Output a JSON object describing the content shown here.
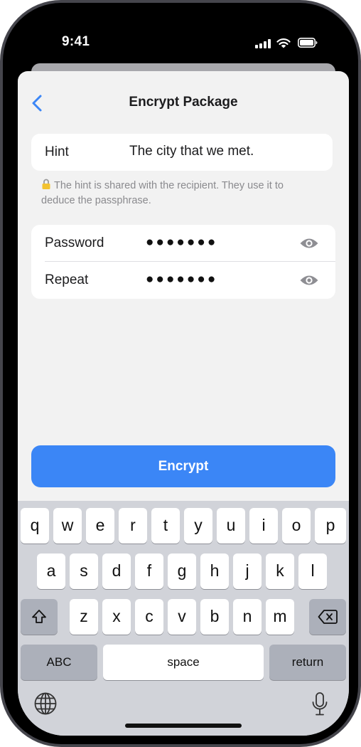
{
  "status": {
    "time": "9:41"
  },
  "nav": {
    "title": "Encrypt Package"
  },
  "hint": {
    "label": "Hint",
    "value": "The city that we met."
  },
  "note": {
    "text": "The hint is shared with the recipient. They use it to deduce the passphrase."
  },
  "password": {
    "label": "Password",
    "masked": "●●●●●●●"
  },
  "repeat": {
    "label": "Repeat",
    "masked": "●●●●●●●"
  },
  "actions": {
    "encrypt_label": "Encrypt"
  },
  "keyboard": {
    "row1": [
      "q",
      "w",
      "e",
      "r",
      "t",
      "y",
      "u",
      "i",
      "o",
      "p"
    ],
    "row2": [
      "a",
      "s",
      "d",
      "f",
      "g",
      "h",
      "j",
      "k",
      "l"
    ],
    "row3": [
      "z",
      "x",
      "c",
      "v",
      "b",
      "n",
      "m"
    ],
    "abc_label": "ABC",
    "space_label": "space",
    "return_label": "return"
  },
  "colors": {
    "accent": "#3b86f6",
    "background": "#f2f2f2",
    "keyboard": "#d1d3d9"
  },
  "icons": [
    "back-chevron-icon",
    "lock-icon",
    "eye-icon",
    "shift-icon",
    "delete-icon",
    "globe-icon",
    "mic-icon"
  ]
}
